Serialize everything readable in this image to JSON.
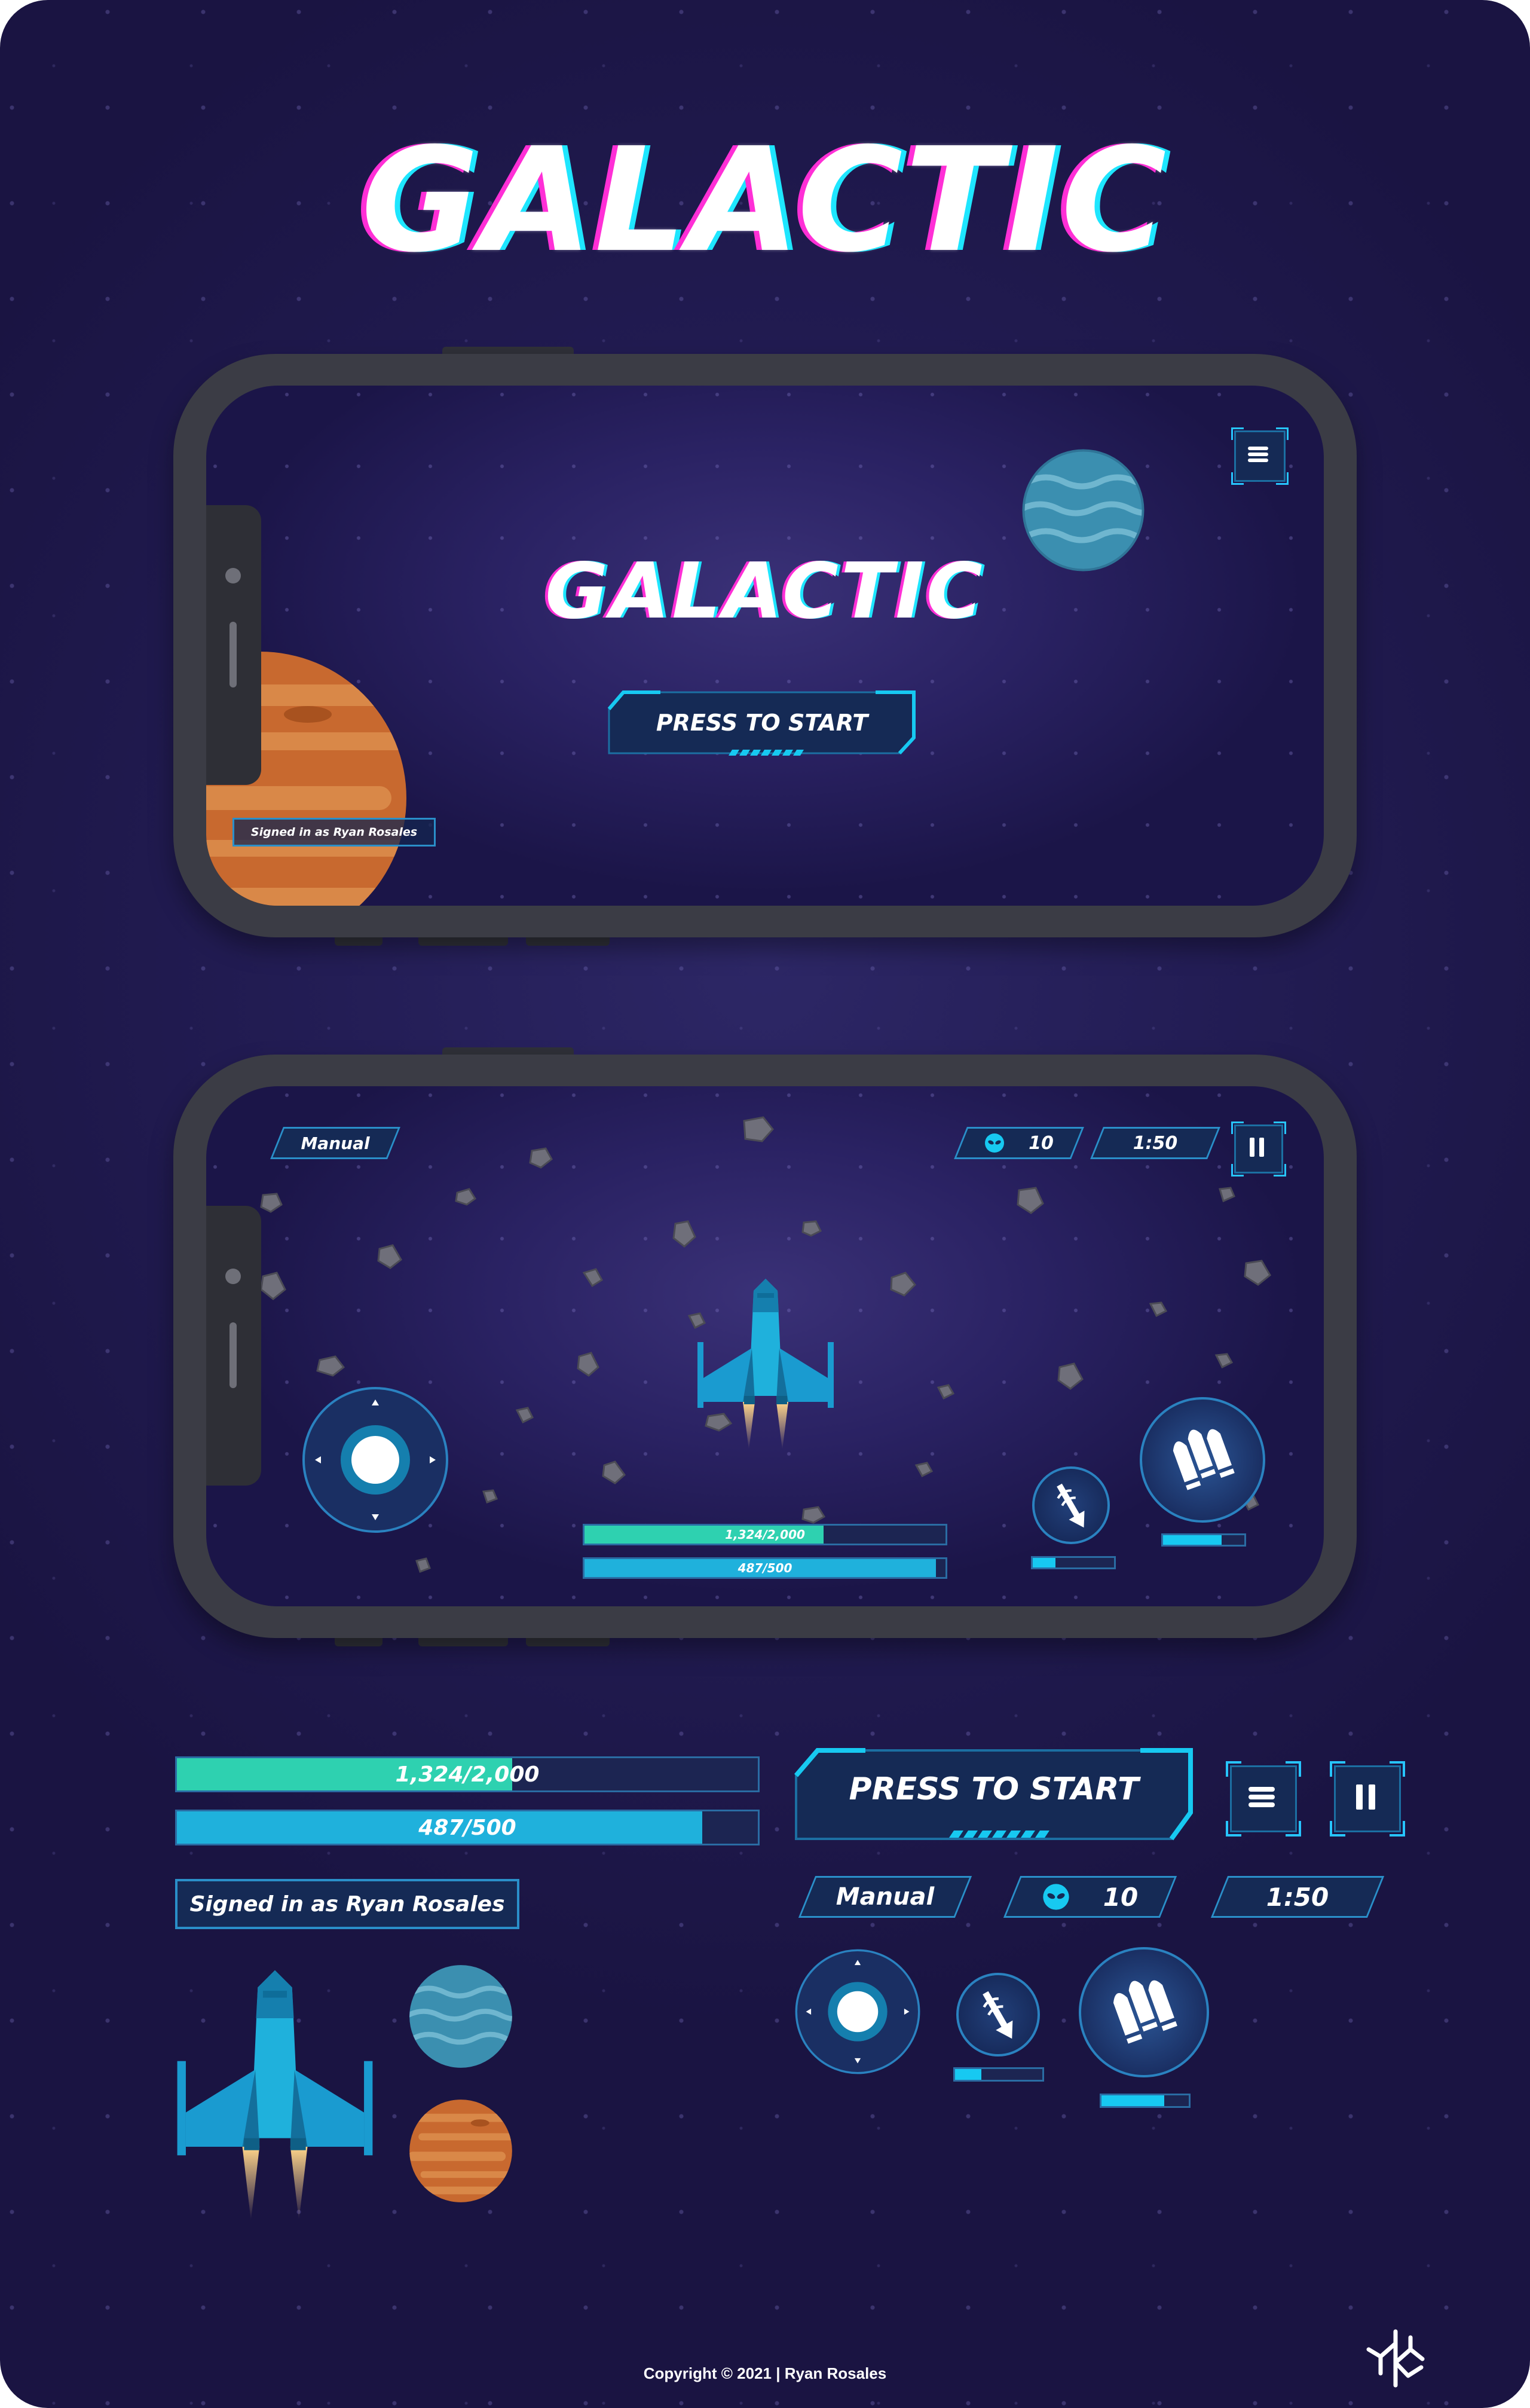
{
  "title": "GALACTIC",
  "colors": {
    "background": "#231d55",
    "accent_cyan": "#17c9f1",
    "health_green": "#2ed1b0",
    "shield_blue": "#1fb1dc",
    "panel": "#152a55",
    "panel_border": "#2a8fc9",
    "ship": "#1a9bd0",
    "planet_blue": "#3b8fb0",
    "planet_orange": "#c8692f"
  },
  "start_screen": {
    "menu_icon": "hamburger-menu-icon",
    "logo": "GALACTIC",
    "press_to_start": "PRESS TO START",
    "signed_in": "Signed in as Ryan Rosales"
  },
  "game_screen": {
    "mode": "Manual",
    "enemy_icon": "alien-head-icon",
    "enemies": "10",
    "timer": "1:50",
    "pause_icon": "pause-icon",
    "health_text": "1,324/2,000",
    "health_fraction": 0.662,
    "shield_text": "487/500",
    "shield_fraction": 0.974,
    "laser_icon": "laser-beam-icon",
    "laser_cooldown": 0.28,
    "missiles_icon": "missiles-icon",
    "missiles_cooldown": 0.72
  },
  "components": {
    "health_text": "1,324/2,000",
    "health_fraction": 0.577,
    "shield_text": "487/500",
    "shield_fraction": 0.904,
    "signed_in": "Signed in as Ryan Rosales",
    "press_to_start": "PRESS TO START",
    "menu_icon": "hamburger-menu-icon",
    "pause_icon": "pause-icon",
    "mode": "Manual",
    "enemies": "10",
    "timer": "1:50",
    "laser_cooldown": 0.3,
    "missiles_cooldown": 0.72
  },
  "footer": {
    "copyright": "Copyright © 2021 | Ryan Rosales",
    "logo_icon": "author-monogram-logo"
  }
}
